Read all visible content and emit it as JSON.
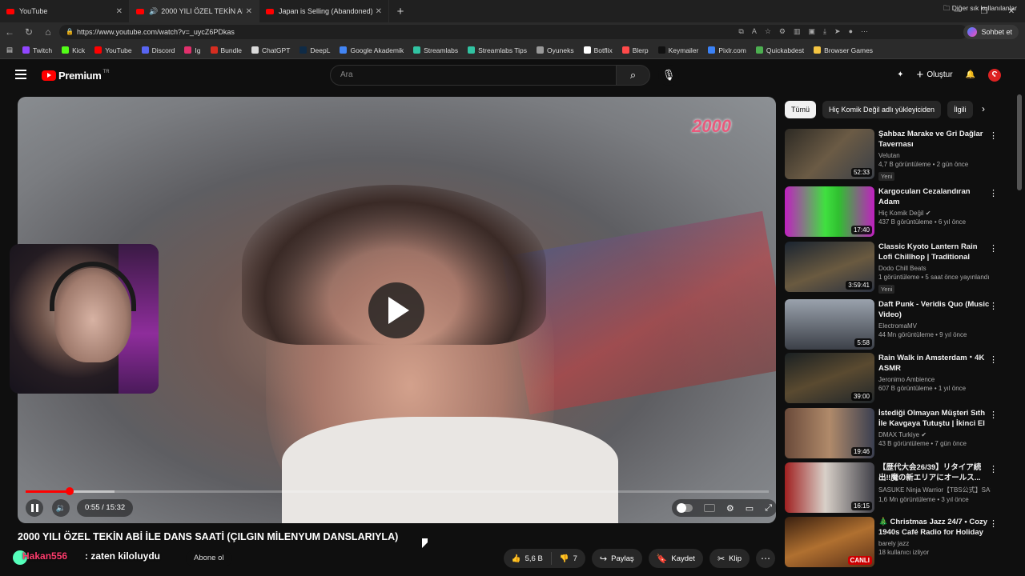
{
  "browser": {
    "tabs": [
      {
        "label": "YouTube",
        "active": false
      },
      {
        "label": "2000 YILI ÖZEL TEKİN ABİ İLE",
        "active": true
      },
      {
        "label": "Japan is Selling (Abandoned) Hou",
        "active": false
      }
    ],
    "url": "https://www.youtube.com/watch?v=_uycZ6PDkas",
    "chat_label": "Sohbet et",
    "bookmarks": [
      {
        "label": "Twitch",
        "color": "#9146ff"
      },
      {
        "label": "Kick",
        "color": "#53fc18"
      },
      {
        "label": "YouTube",
        "color": "#ff0000"
      },
      {
        "label": "Discord",
        "color": "#5865f2"
      },
      {
        "label": "Ig",
        "color": "#e1306c"
      },
      {
        "label": "Bundle",
        "color": "#d62d20"
      },
      {
        "label": "ChatGPT",
        "color": "#d9d9d9"
      },
      {
        "label": "DeepL",
        "color": "#0f2b46"
      },
      {
        "label": "Google Akademik",
        "color": "#4285f4"
      },
      {
        "label": "Streamlabs",
        "color": "#31c3a2"
      },
      {
        "label": "Streamlabs Tips",
        "color": "#31c3a2"
      },
      {
        "label": "Oyuneks",
        "color": "#999999"
      },
      {
        "label": "Botflix",
        "color": "#ffffff"
      },
      {
        "label": "Blerp",
        "color": "#ff4a4a"
      },
      {
        "label": "Keymailer",
        "color": "#111111"
      },
      {
        "label": "Pixlr.com",
        "color": "#3b82f6"
      },
      {
        "label": "Quickabdest",
        "color": "#4caf50"
      },
      {
        "label": "Browser Games",
        "color": "#f5c542"
      }
    ],
    "bookmarks_more": "Diğer sık kullanılanlar"
  },
  "youtube_header": {
    "brand": "Premium",
    "country": "TR",
    "search_placeholder": "Ara",
    "create_label": "Oluştur",
    "avatar_letter": "Ϛ"
  },
  "player": {
    "watermark": "2000",
    "current_time": "0:55",
    "duration": "15:32",
    "time_display": "0:55 / 15:32",
    "progress_fraction": 0.059,
    "buffered_fraction": 0.12
  },
  "video": {
    "title": "2000 YILI ÖZEL TEKİN ABİ İLE DANS SAATİ (ÇILGIN MİLENYUM DANSLARIYLA)",
    "subscribe_label": "Abone ol",
    "likes": "5,6 B",
    "dislikes": "7",
    "share_label": "Paylaş",
    "save_label": "Kaydet",
    "clip_label": "Klip"
  },
  "stream_overlay": {
    "username": "Hakan556",
    "message": ": zaten kiloluydu"
  },
  "sidebar": {
    "chips": [
      {
        "label": "Tümü",
        "active": true
      },
      {
        "label": "Hiç Komik Değil adlı yükleyiciden",
        "active": false
      },
      {
        "label": "İlgili",
        "active": false
      }
    ],
    "recommendations": [
      {
        "title": "Şahbaz Marake ve Gri Dağlar Tavernası",
        "channel": "Velutan",
        "meta": "4,7 B görüntüleme • 2 gün önce",
        "badge": "Yeni",
        "duration": "52:33",
        "thumb": "linear-gradient(135deg,#2d2a24,#6b5b45 50%,#3a3f46)"
      },
      {
        "title": "Kargocuları Cezalandıran Adam",
        "channel": "Hiç Komik Değil",
        "verified": true,
        "meta": "437 B görüntüleme • 6 yıl önce",
        "duration": "17:40",
        "thumb": "linear-gradient(90deg,#c020c0,#40e040 45%,#30c030 60%,#c020c0)"
      },
      {
        "title": "Classic Kyoto Lantern Rain Lofi Chillhop | Traditional Neon ...",
        "channel": "Dodo Chill Beats",
        "meta": "1 görüntüleme • 5 saat önce yayınlandı",
        "badge": "Yeni",
        "duration": "3:59:41",
        "thumb": "linear-gradient(160deg,#1a2430,#6a5a40 55%,#2b3240)"
      },
      {
        "title": "Daft Punk - Veridis Quo (Music Video)",
        "channel": "ElectromaMV",
        "meta": "44 Mn görüntüleme • 9 yıl önce",
        "duration": "5:58",
        "thumb": "linear-gradient(180deg,#9aa2ad,#3c4048)"
      },
      {
        "title": "Rain Walk in Amsterdam・4K ASMR",
        "channel": "Jeronimo Ambience",
        "meta": "607 B görüntüleme • 1 yıl önce",
        "duration": "39:00",
        "thumb": "linear-gradient(160deg,#1a2022,#5a4a30 50%,#20262a)"
      },
      {
        "title": "İstediği Olmayan Müşteri Sıth İle Kavgaya Tutuştu | İkinci El ...",
        "channel": "DMAX Turkiye",
        "verified": true,
        "meta": "43 B görüntüleme • 7 gün önce",
        "duration": "19:46",
        "thumb": "linear-gradient(90deg,#6a4a3a,#b08a6a 50%,#3a3f50)"
      },
      {
        "title": "【歴代大会26/39】リタイア続出‼魔の新エリアにオールス...",
        "channel": "SASUKE Ninja Warrior【TBS公式】SASU...",
        "meta": "1,6 Mn görüntüleme • 3 yıl önce",
        "duration": "16:15",
        "thumb": "linear-gradient(90deg,#a02020,#d8d0c8 45%,#404048)"
      },
      {
        "title": "🎄 Christmas Jazz 24/7 • Cozy 1940s Café Radio for Holiday ...",
        "channel": "barely jazz",
        "meta": "18 kullanıcı izliyor",
        "duration": "CANLI",
        "live": true,
        "thumb": "linear-gradient(160deg,#3a2010,#b07030 50%,#5a3018)"
      }
    ]
  }
}
